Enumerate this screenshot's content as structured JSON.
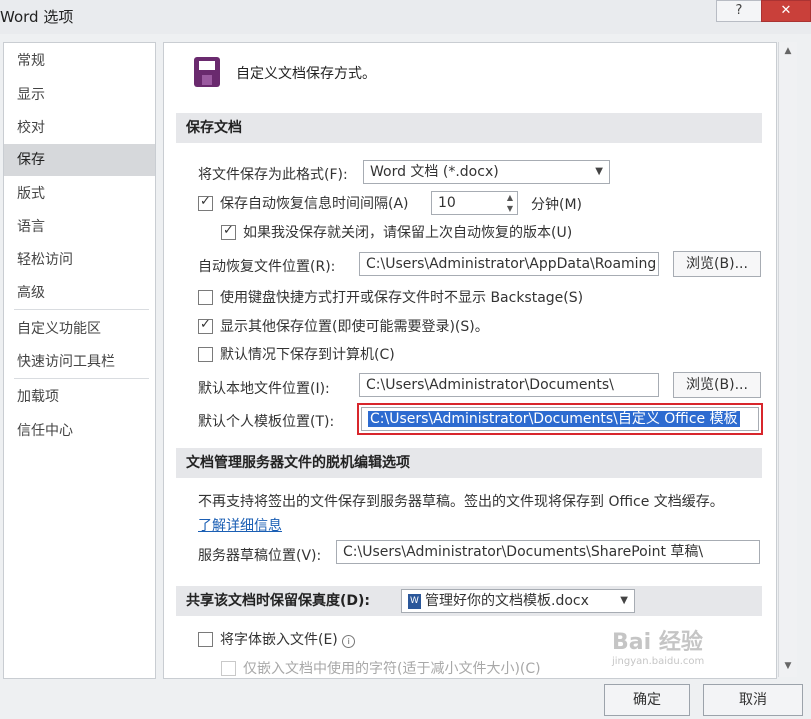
{
  "window": {
    "title": "Word 选项",
    "help_label": "?",
    "close_label": "✕"
  },
  "nav": {
    "items": [
      {
        "label": "常规"
      },
      {
        "label": "显示"
      },
      {
        "label": "校对"
      },
      {
        "label": "保存"
      },
      {
        "label": "版式"
      },
      {
        "label": "语言"
      },
      {
        "label": "轻松访问"
      },
      {
        "label": "高级"
      },
      {
        "label": "自定义功能区"
      },
      {
        "label": "快速访问工具栏"
      },
      {
        "label": "加载项"
      },
      {
        "label": "信任中心"
      }
    ],
    "active_index": 3
  },
  "header": {
    "title": "自定义文档保存方式。",
    "icon": "floppy-disk-icon"
  },
  "save_docs": {
    "section_title": "保存文档",
    "format_label": "将文件保存为此格式(F):",
    "format_value": "Word 文档 (*.docx)",
    "autorecover_label": "保存自动恢复信息时间间隔(A)",
    "autorecover_checked": true,
    "autorecover_minutes": "10",
    "minutes_label": "分钟(M)",
    "keep_last_label": "如果我没保存就关闭，请保留上次自动恢复的版本(U)",
    "keep_last_checked": true,
    "autorecover_location_label": "自动恢复文件位置(R):",
    "autorecover_location_value": "C:\\Users\\Administrator\\AppData\\Roaming",
    "browse_label": "浏览(B)...",
    "backstage_label": "使用键盘快捷方式打开或保存文件时不显示 Backstage(S)",
    "backstage_checked": false,
    "show_other_label": "显示其他保存位置(即使可能需要登录)(S)。",
    "show_other_checked": true,
    "save_computer_label": "默认情况下保存到计算机(C)",
    "save_computer_checked": false,
    "local_location_label": "默认本地文件位置(I):",
    "local_location_value": "C:\\Users\\Administrator\\Documents\\",
    "browse2_label": "浏览(B)...",
    "template_location_label": "默认个人模板位置(T):",
    "template_location_value": "C:\\Users\\Administrator\\Documents\\自定义 Office 模板"
  },
  "offline": {
    "section_title": "文档管理服务器文件的脱机编辑选项",
    "notice": "不再支持将签出的文件保存到服务器草稿。签出的文件现将保存到 Office 文档缓存。",
    "learn_more": "了解详细信息",
    "drafts_label": "服务器草稿位置(V):",
    "drafts_value": "C:\\Users\\Administrator\\Documents\\SharePoint 草稿\\"
  },
  "fidelity": {
    "section_title": "共享该文档时保留保真度(D):",
    "doc_value": "管理好你的文档模板.docx",
    "doc_icon": "word-document-icon",
    "embed_label": "将字体嵌入文件(E)",
    "embed_checked": false,
    "embed_only_label": "仅嵌入文档中使用的字符(适于减小文件大小)(C)",
    "info_icon": "info-icon"
  },
  "footer": {
    "ok_label": "确定",
    "cancel_label": "取消"
  },
  "watermark": {
    "text": "Bai 经验",
    "sub": "jingyan.baidu.com"
  },
  "colors": {
    "highlight_border": "#d8262c",
    "selection": "#2d6bd0",
    "link": "#1b5fb4",
    "active_nav": "#d6d8db"
  }
}
